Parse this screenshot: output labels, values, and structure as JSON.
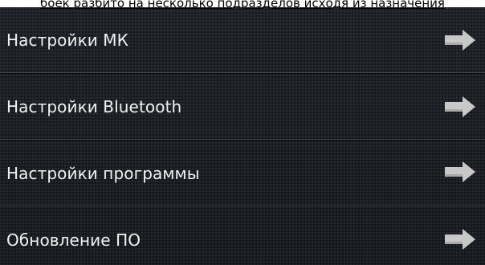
{
  "caption": "боек разбито на несколько подразделов исходя из назначения",
  "menu": {
    "items": [
      {
        "label": "Настройки МК",
        "icon": "arrow-right-icon"
      },
      {
        "label": "Настройки Bluetooth",
        "icon": "arrow-right-icon"
      },
      {
        "label": "Настройки программы",
        "icon": "arrow-right-icon"
      },
      {
        "label": "Обновление ПО",
        "icon": "arrow-right-icon"
      }
    ]
  },
  "colors": {
    "background": "#1b1f24",
    "text": "#f2f2f2",
    "divider": "#3e4550",
    "arrow": "#c8c8c8"
  }
}
